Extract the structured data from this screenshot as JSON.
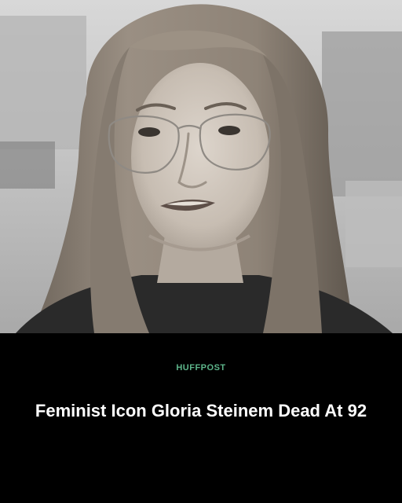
{
  "photo": {
    "subject": "woman-with-long-hair-and-glasses-portrait",
    "colors": {
      "background": "#c4c4c4",
      "hair": "#8a8074",
      "skin": "#cfc6bd",
      "shadow": "#2a2a2a"
    }
  },
  "caption": {
    "brand": "HUFFPOST",
    "headline": "Feminist Icon Gloria Steinem Dead At 92",
    "colors": {
      "background": "#000000",
      "brand": "#5db58a",
      "headline": "#ffffff"
    }
  }
}
